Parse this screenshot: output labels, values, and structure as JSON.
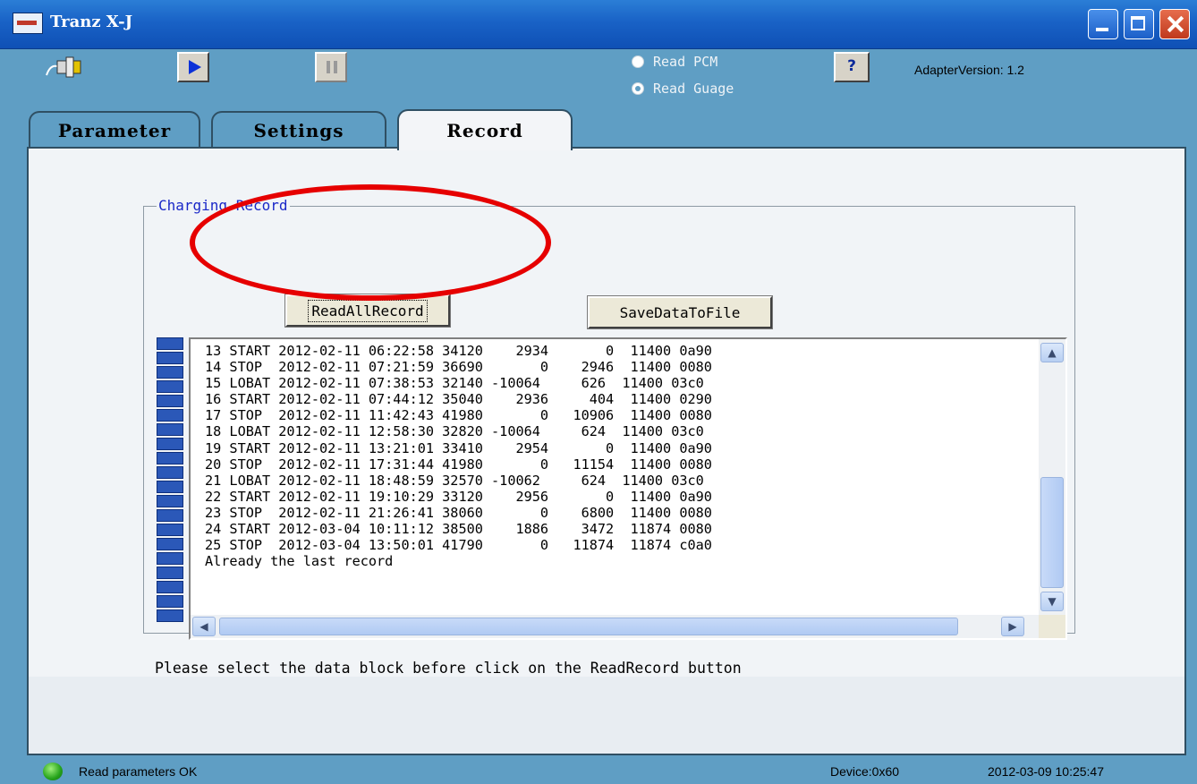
{
  "window": {
    "title": "Tranz X-J"
  },
  "toolbar": {
    "connect_icon": "plug-connector-icon",
    "play_icon": "play-icon",
    "pause_icon": "pause-icon",
    "help_icon": "help-pointer-icon",
    "help_label": "?",
    "radio_options": [
      {
        "label": "Read PCM",
        "checked": false
      },
      {
        "label": "Read Guage",
        "checked": true
      }
    ],
    "adapter_version": "AdapterVersion: 1.2"
  },
  "tabs": [
    {
      "label": "Parameter",
      "active": false
    },
    {
      "label": "Settings",
      "active": false
    },
    {
      "label": "Record",
      "active": true
    }
  ],
  "group": {
    "label": "Charging Record",
    "read_button": "ReadAllRecord",
    "save_button": "SaveDataToFile",
    "records_text": "13 START 2012-02-11 06:22:58 34120    2934       0  11400 0a90\n14 STOP  2012-02-11 07:21:59 36690       0    2946  11400 0080\n15 LOBAT 2012-02-11 07:38:53 32140 -10064     626  11400 03c0\n16 START 2012-02-11 07:44:12 35040    2936     404  11400 0290\n17 STOP  2012-02-11 11:42:43 41980       0   10906  11400 0080\n18 LOBAT 2012-02-11 12:58:30 32820 -10064     624  11400 03c0\n19 START 2012-02-11 13:21:01 33410    2954       0  11400 0a90\n20 STOP  2012-02-11 17:31:44 41980       0   11154  11400 0080\n21 LOBAT 2012-02-11 18:48:59 32570 -10062     624  11400 03c0\n22 START 2012-02-11 19:10:29 33120    2956       0  11400 0a90\n23 STOP  2012-02-11 21:26:41 38060       0    6800  11400 0080\n24 START 2012-03-04 10:11:12 38500    1886    3472  11874 0080\n25 STOP  2012-03-04 13:50:01 41790       0   11874  11874 c0a0",
    "records_footer": "Already the last record",
    "hint": "Please select the data block  before click on the ReadRecord button"
  },
  "status": {
    "message": "Read parameters OK",
    "device": "Device:0x60",
    "datetime": "2012-03-09 10:25:47",
    "led_color": "#24a21a"
  },
  "colors": {
    "titlebar": "#1962c6",
    "window_bg": "#5f9ec4",
    "annotation": "#e60000",
    "group_label": "#1a28c8"
  }
}
